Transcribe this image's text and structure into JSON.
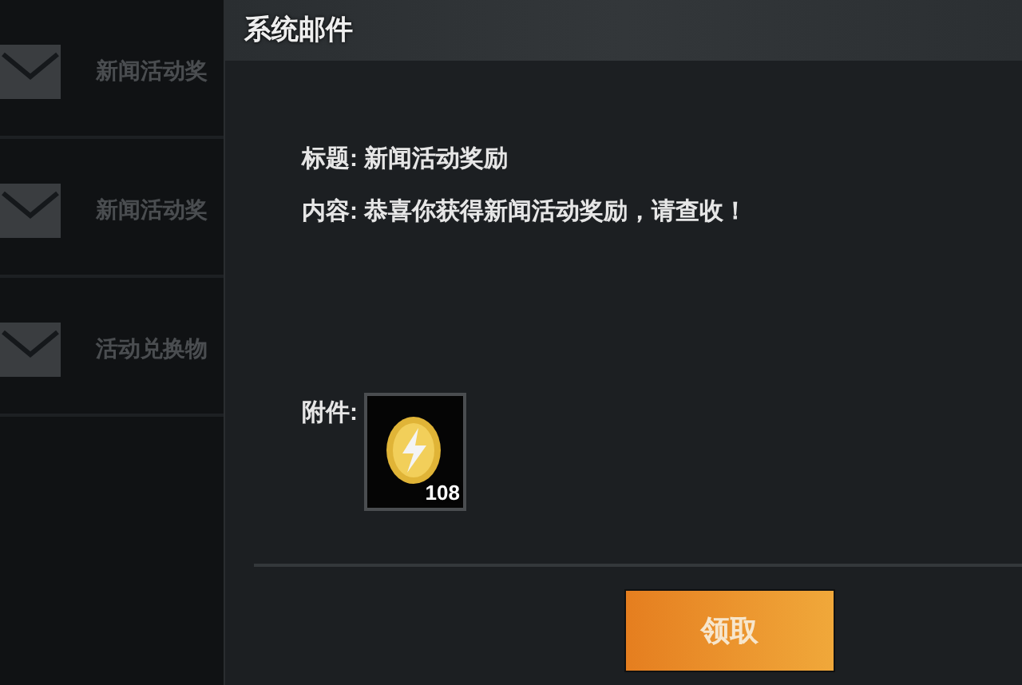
{
  "mail_list": [
    {
      "title": "新闻活动奖"
    },
    {
      "title": "新闻活动奖"
    },
    {
      "title": "活动兑换物"
    }
  ],
  "mail_panel": {
    "title": "系统邮件",
    "subject_label": "标题:",
    "subject": "新闻活动奖励",
    "content_label": "内容:",
    "content": "恭喜你获得新闻活动奖励，请查收！",
    "attachment_label": "附件:",
    "attachments": [
      {
        "count": "108"
      }
    ],
    "claim_button": "领取"
  }
}
